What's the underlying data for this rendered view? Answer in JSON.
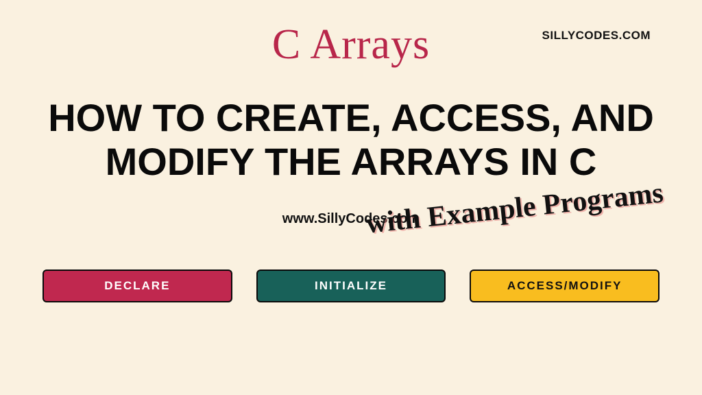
{
  "brand": "SILLYCODES.COM",
  "script_title": "C Arrays",
  "main_title": "HOW TO CREATE, ACCESS, AND MODIFY THE ARRAYS IN C",
  "url": "www.SillyCodes.com",
  "subtitle": "with Example Programs",
  "buttons": {
    "declare": "DECLARE",
    "initialize": "INITIALIZE",
    "access": "ACCESS/MODIFY"
  },
  "colors": {
    "background": "#faf1e0",
    "accent_red": "#c0284f",
    "accent_teal": "#186159",
    "accent_yellow": "#f9bd1f",
    "text_dark": "#0a0a0a",
    "script_red": "#b8264a"
  }
}
